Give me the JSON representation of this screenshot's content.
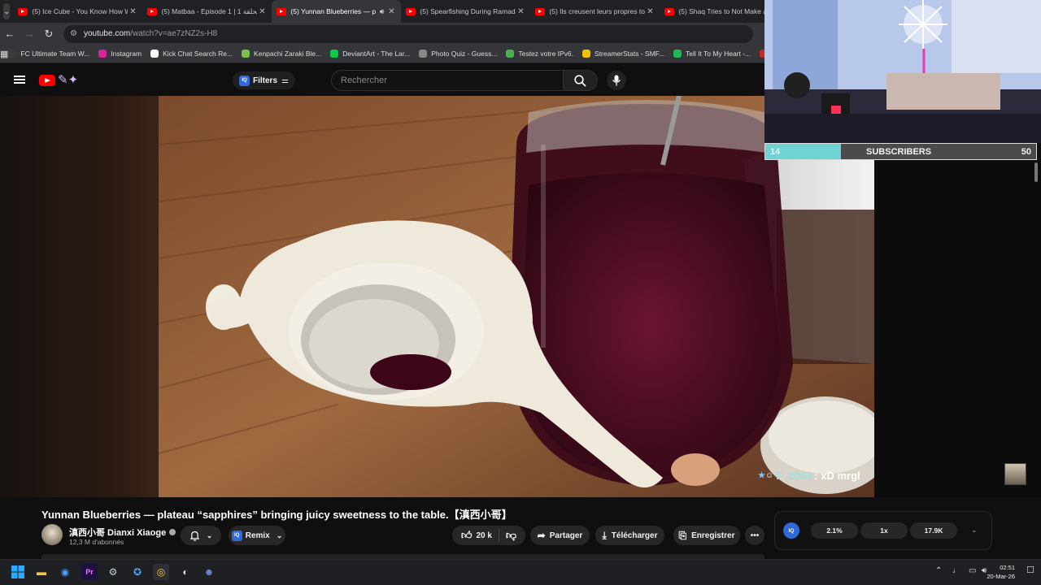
{
  "browser": {
    "tabs": [
      {
        "title": "(5) Ice Cube - You Know How W",
        "active": false,
        "audio": false
      },
      {
        "title": "(5) Matbaa - Episode 1 | 1 الحلقة",
        "active": false,
        "audio": false
      },
      {
        "title": "(5) Yunnan Blueberries — p",
        "active": true,
        "audio": true
      },
      {
        "title": "(5) Spearfishing During Ramada",
        "active": false,
        "audio": false
      },
      {
        "title": "(5) Ils creusent leurs propres to",
        "active": false,
        "audio": false
      },
      {
        "title": "(5) Shaq Tries to Not Make a",
        "active": false,
        "audio": false
      }
    ],
    "url_host": "youtube.com",
    "url_path": "/watch?v=ae7zNZ2s-H8",
    "bookmarks": [
      {
        "label": "FC Ultimate Team W...",
        "color": "#3b3b3b"
      },
      {
        "label": "Instagram",
        "color": "#d6249f"
      },
      {
        "label": "Kick Chat Search Re...",
        "color": "#ffffff"
      },
      {
        "label": "Kenpachi Zaraki Ble...",
        "color": "#7cbf4f"
      },
      {
        "label": "DeviantArt - The Lar...",
        "color": "#05cc47"
      },
      {
        "label": "Photo Quiz - Guess...",
        "color": "#888888"
      },
      {
        "label": "Testez votre IPv6.",
        "color": "#4caf50"
      },
      {
        "label": "StreamerStats - SMF...",
        "color": "#f2c200"
      },
      {
        "label": "Tell It To My Heart -...",
        "color": "#1db954"
      },
      {
        "label": "Globa",
        "color": "#c62828"
      }
    ]
  },
  "youtube": {
    "filters_label": "Filters",
    "search_placeholder": "Rechercher",
    "title": "Yunnan Blueberries — plateau “sapphires” bringing juicy sweetness to the table.【滇西小哥】",
    "channel": "滇西小哥 Dianxi Xiaoge",
    "subscribers": "12,3 M d'abonnés",
    "remix": "Remix",
    "likes": "20 k",
    "share": "Partager",
    "download": "Télécharger",
    "save": "Enregistrer",
    "iq_label": "IQ",
    "iq_stats": [
      "2.1%",
      "1x",
      "17.9K"
    ]
  },
  "stream": {
    "sub_current": "14",
    "sub_label": "SUBSCRIBERS",
    "sub_goal": "50",
    "sub_progress": 0.28,
    "chat_user": "F_2004",
    "chat_msg": ": xD mrgl"
  },
  "taskbar": {
    "time": "02:51",
    "date": "20-Mar-26"
  }
}
